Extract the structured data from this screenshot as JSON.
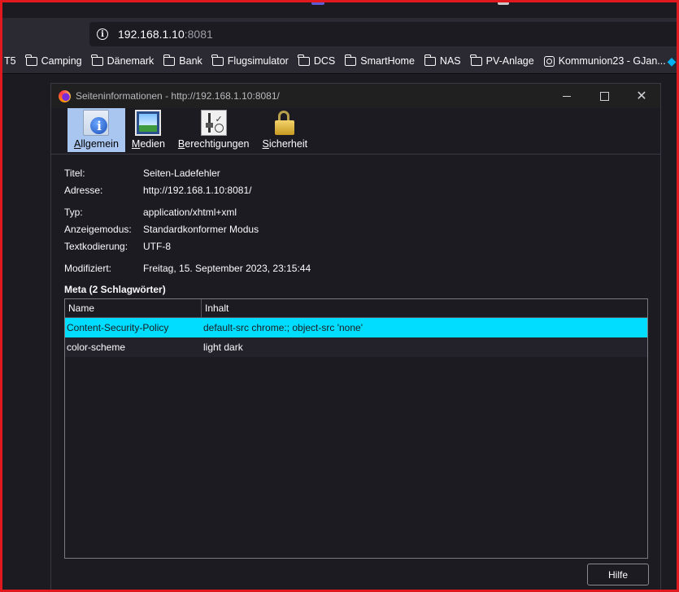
{
  "browser": {
    "url_host": "192.168.1.10",
    "url_port": ":8081",
    "bookmarks": [
      {
        "label": "T5",
        "icon": "none"
      },
      {
        "label": "Camping",
        "icon": "folder-icon"
      },
      {
        "label": "Dänemark",
        "icon": "folder-icon"
      },
      {
        "label": "Bank",
        "icon": "folder-icon"
      },
      {
        "label": "Flugsimulator",
        "icon": "folder-icon"
      },
      {
        "label": "DCS",
        "icon": "folder-icon"
      },
      {
        "label": "SmartHome",
        "icon": "folder-icon"
      },
      {
        "label": "NAS",
        "icon": "folder-icon"
      },
      {
        "label": "PV-Anlage",
        "icon": "folder-icon"
      },
      {
        "label": "Kommunion23 - GJan...",
        "icon": "camera-icon"
      }
    ]
  },
  "dialog": {
    "title": "Seiteninformationen - http://192.168.1.10:8081/",
    "tabs": [
      {
        "label": "Allgemein",
        "accesskey": "A",
        "rest": "llgemein",
        "selected": true
      },
      {
        "label": "Medien",
        "accesskey": "M",
        "rest": "edien",
        "selected": false
      },
      {
        "label": "Berechtigungen",
        "accesskey": "B",
        "rest": "erechtigungen",
        "selected": false
      },
      {
        "label": "Sicherheit",
        "accesskey": "S",
        "rest": "icherheit",
        "selected": false
      }
    ],
    "general": {
      "titel_label": "Titel:",
      "titel_value": "Seiten-Ladefehler",
      "adresse_label": "Adresse:",
      "adresse_value": "http://192.168.1.10:8081/",
      "typ_label": "Typ:",
      "typ_value": "application/xhtml+xml",
      "modus_label": "Anzeigemodus:",
      "modus_value": "Standardkonformer Modus",
      "kodierung_label": "Textkodierung:",
      "kodierung_value": "UTF-8",
      "modifiziert_label": "Modifiziert:",
      "modifiziert_value": "Freitag, 15. September 2023, 23:15:44"
    },
    "meta": {
      "heading": "Meta (2 Schlagwörter)",
      "columns": [
        "Name",
        "Inhalt"
      ],
      "rows": [
        {
          "name": "Content-Security-Policy",
          "content": "default-src chrome:; object-src 'none'"
        },
        {
          "name": "color-scheme",
          "content": "light dark"
        }
      ]
    },
    "help_button": "Hilfe"
  },
  "colors": {
    "selection": "#00ddff",
    "tab_selected": "#a8c6f0",
    "frame_border": "#e0191e"
  }
}
